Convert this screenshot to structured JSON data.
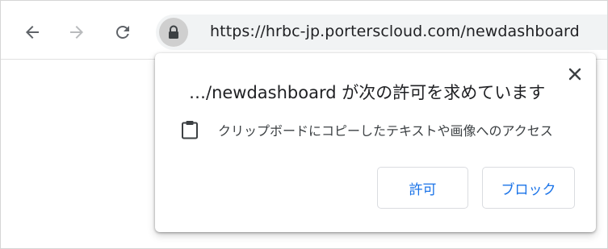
{
  "toolbar": {
    "back_icon": "arrow-left-icon",
    "forward_icon": "arrow-right-icon",
    "reload_icon": "reload-icon",
    "lock_icon": "lock-icon",
    "url": "https://hrbc-jp.porterscloud.com/newdashboard"
  },
  "permission_prompt": {
    "title": "…/newdashboard が次の許可を求めています",
    "close_icon": "close-icon",
    "permission_icon": "clipboard-icon",
    "permission_text": "クリップボードにコピーしたテキストや画像へのアクセス",
    "allow_label": "許可",
    "block_label": "ブロック"
  },
  "colors": {
    "accent": "#1a73e8",
    "omnibox_bg": "#f1f3f4",
    "icon_gray": "#5f6368"
  }
}
